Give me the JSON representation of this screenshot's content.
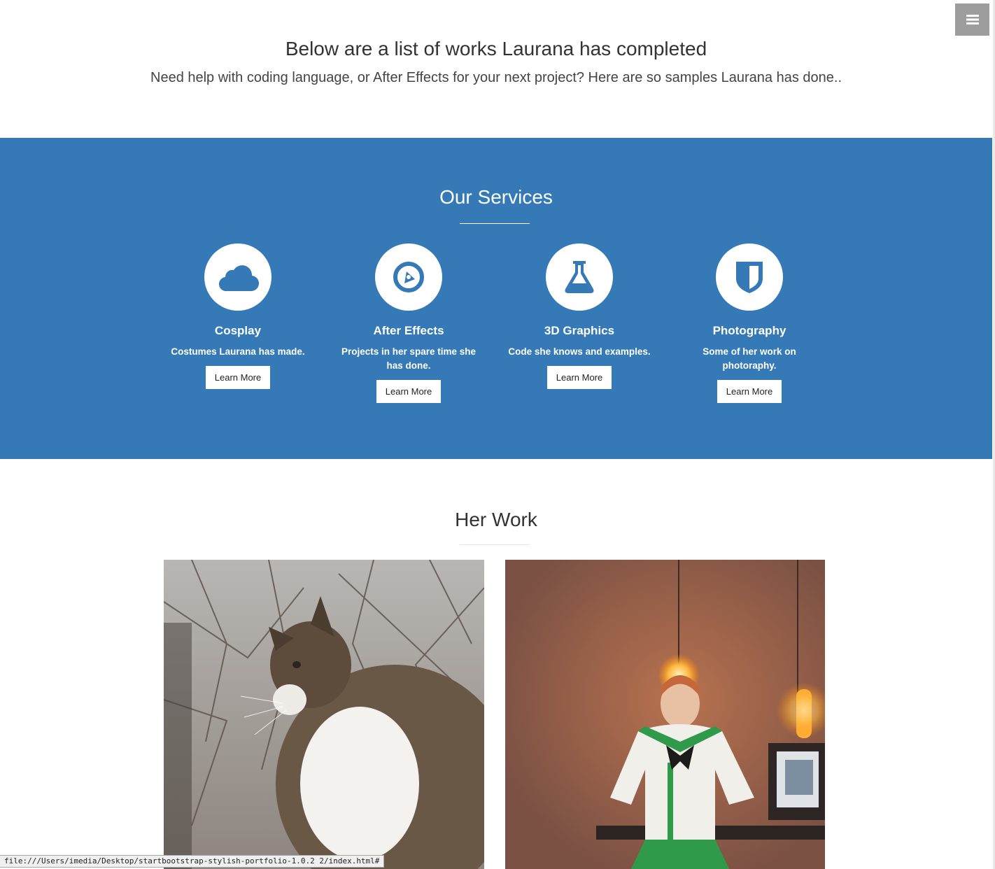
{
  "intro": {
    "title": "Below are a list of works Laurana has completed",
    "subtitle": "Need help with coding language, or After Effects for your next project? Here are so samples Laurana has done.."
  },
  "services": {
    "heading": "Our Services",
    "background_color": "#3579b7",
    "items": [
      {
        "icon": "cloud-icon",
        "title": "Cosplay",
        "description": "Costumes Laurana has made.",
        "button": "Learn More"
      },
      {
        "icon": "compass-icon",
        "title": "After Effects",
        "description": "Projects in her spare time she has done.",
        "button": "Learn More"
      },
      {
        "icon": "flask-icon",
        "title": "3D Graphics",
        "description": "Code she knows and examples.",
        "button": "Learn More"
      },
      {
        "icon": "shield-icon",
        "title": "Photography",
        "description": "Some of her work on photoraphy.",
        "button": "Learn More"
      }
    ]
  },
  "work": {
    "heading": "Her Work",
    "photos": [
      {
        "subject": "cat-photo"
      },
      {
        "subject": "cosplay-photo"
      }
    ]
  },
  "menu": {
    "icon": "hamburger-icon"
  },
  "status_bar": {
    "url": "file:///Users/imedia/Desktop/startbootstrap-stylish-portfolio-1.0.2 2/index.html#"
  }
}
